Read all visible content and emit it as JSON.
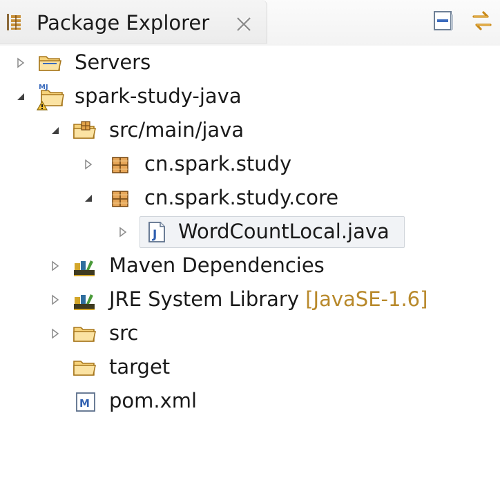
{
  "view": {
    "title": "Package Explorer"
  },
  "tree": [
    {
      "label": "Servers",
      "decoration": "",
      "expanded": false
    },
    {
      "label": "spark-study-java",
      "decoration": "",
      "expanded": true
    },
    {
      "label": "src/main/java",
      "decoration": "",
      "expanded": true
    },
    {
      "label": "cn.spark.study",
      "decoration": "",
      "expanded": false
    },
    {
      "label": "cn.spark.study.core",
      "decoration": "",
      "expanded": true
    },
    {
      "label": "WordCountLocal.java",
      "decoration": "",
      "expanded": false,
      "selected": true
    },
    {
      "label": "Maven Dependencies",
      "decoration": "",
      "expanded": false
    },
    {
      "label": "JRE System Library",
      "decoration": "[JavaSE-1.6]",
      "expanded": false
    },
    {
      "label": "src",
      "decoration": "",
      "expanded": false
    },
    {
      "label": "target",
      "decoration": "",
      "expanded": false
    },
    {
      "label": "pom.xml",
      "decoration": "",
      "expanded": false
    }
  ],
  "colors": {
    "folder": "#e8b64a",
    "package": "#b5651d",
    "java_file": "#3b6bbd",
    "decoration": "#b8892b"
  }
}
